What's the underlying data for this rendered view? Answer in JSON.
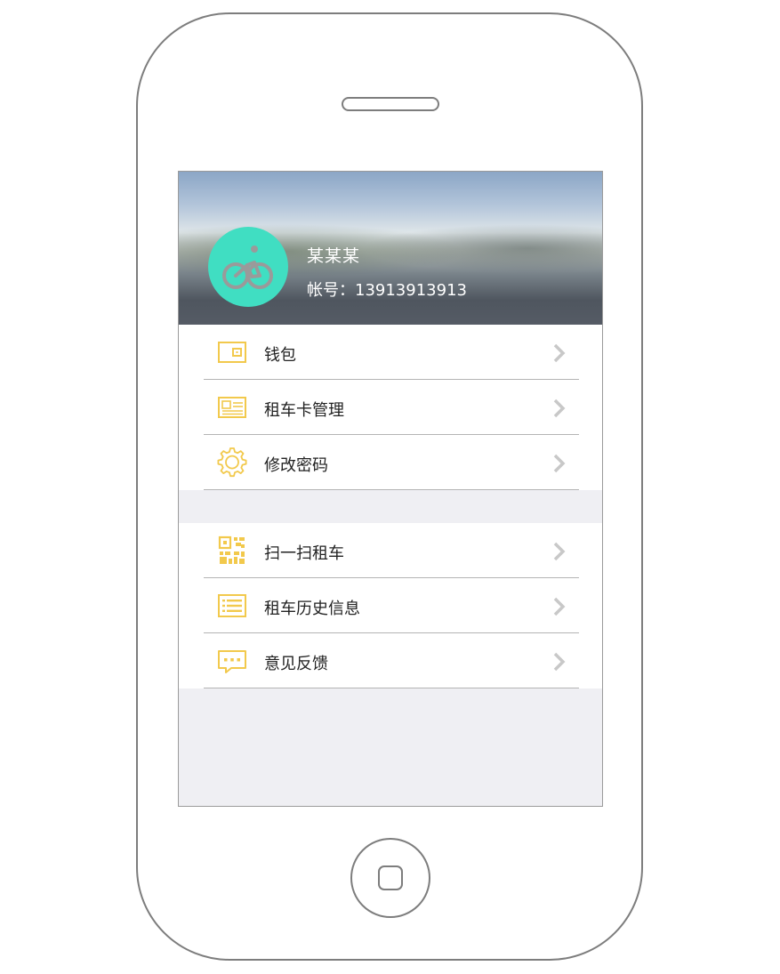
{
  "profile": {
    "name": "某某某",
    "account_label": "帐号：",
    "account_number": "13913913913"
  },
  "menu_group_1": [
    {
      "label": "钱包",
      "icon": "wallet-icon"
    },
    {
      "label": "租车卡管理",
      "icon": "id-card-icon"
    },
    {
      "label": "修改密码",
      "icon": "gear-icon"
    }
  ],
  "menu_group_2": [
    {
      "label": "扫一扫租车",
      "icon": "qr-code-icon"
    },
    {
      "label": "租车历史信息",
      "icon": "list-icon"
    },
    {
      "label": "意见反馈",
      "icon": "chat-bubble-icon"
    }
  ],
  "colors": {
    "accent": "#f2c94c",
    "avatar": "#40dec2",
    "chevron": "#c8c8c8",
    "background": "#efeff3"
  }
}
